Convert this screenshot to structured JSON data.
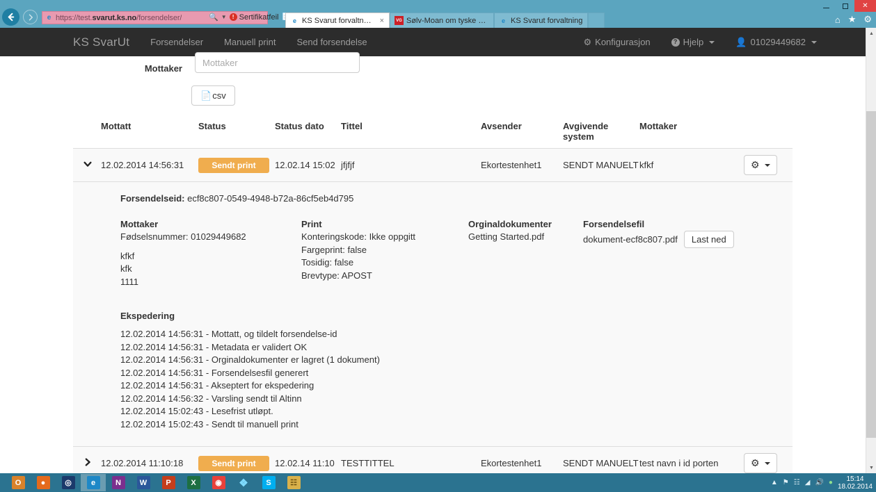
{
  "browser": {
    "url_prefix": "https://test.",
    "url_domain": "svarut.ks.no",
    "url_path": "/forsendelser/",
    "security_warning": "Sertifikatfeil",
    "back_icon": "back-arrow-icon",
    "forward_icon": "forward-arrow-icon",
    "search_icon": "search-icon",
    "refresh_icon": "refresh-icon",
    "home_icon": "home-icon",
    "favorites_icon": "star-icon",
    "tools_icon": "gear-icon",
    "minimize_label": "─",
    "maximize_label": "❐",
    "close_label": "✕",
    "tabs": [
      {
        "title": "KS Svarut forvaltning",
        "active": true,
        "icon": "ie-icon",
        "close": "×"
      },
      {
        "title": "Sølv-Moan om tyske konkure...",
        "active": false,
        "icon": "news-icon",
        "close": ""
      },
      {
        "title": "KS Svarut forvaltning",
        "active": false,
        "icon": "ie-icon",
        "close": ""
      }
    ]
  },
  "navbar": {
    "brand": "KS SvarUt",
    "links": [
      {
        "label": "Forsendelser"
      },
      {
        "label": "Manuell print"
      },
      {
        "label": "Send forsendelse"
      }
    ],
    "right": [
      {
        "label": "Konfigurasjon",
        "icon": "gear-icon",
        "caret": false
      },
      {
        "label": "Hjelp",
        "icon": "question-circle-icon",
        "caret": true
      },
      {
        "label": "01029449682",
        "icon": "user-icon",
        "caret": true
      }
    ]
  },
  "filter": {
    "mottaker_label": "Mottaker",
    "mottaker_value": "",
    "mottaker_placeholder": "Mottaker",
    "csv_button": "csv",
    "csv_icon": "file-icon"
  },
  "table": {
    "headers": {
      "mottatt": "Mottatt",
      "status": "Status",
      "status_dato": "Status dato",
      "tittel": "Tittel",
      "avsender": "Avsender",
      "avgivende_system": "Avgivende system",
      "mottaker": "Mottaker"
    },
    "rows": [
      {
        "expanded": true,
        "caret": "⌄",
        "mottatt": "12.02.2014 14:56:31",
        "status": "Sendt print",
        "status_dato": "12.02.14 15:02",
        "tittel": "jfjfjf",
        "avsender": "Ekortestenhet1",
        "avgivende_system": "SENDT MANUELT",
        "mottaker": "kfkf",
        "actions_icon": "gear-icon",
        "detail": {
          "forsendelseid_label": "Forsendelseid:",
          "forsendelseid_value": "ecf8c807-0549-4948-b72a-86cf5eb4d795",
          "mottaker_heading": "Mottaker",
          "mottaker_lines": [
            "Fødselsnummer: 01029449682",
            "",
            "kfkf",
            "kfk",
            "1111"
          ],
          "print_heading": "Print",
          "print_lines": [
            "Konteringskode: Ikke oppgitt",
            "Fargeprint: false",
            "Tosidig: false",
            "Brevtype: APOST"
          ],
          "orginaldokumenter_heading": "Orginaldokumenter",
          "orginaldokumenter_lines": [
            "Getting Started.pdf"
          ],
          "forsendelsefil_heading": "Forsendelsefil",
          "forsendelsefil_name": "dokument-ecf8c807.pdf",
          "forsendelsefil_button": "Last ned",
          "ekspedering_heading": "Ekspedering",
          "ekspedering_lines": [
            "12.02.2014 14:56:31 - Mottatt, og tildelt forsendelse-id",
            "12.02.2014 14:56:31 - Metadata er validert OK",
            "12.02.2014 14:56:31 - Orginaldokumenter er lagret (1 dokument)",
            "12.02.2014 14:56:31 - Forsendelsesfil generert",
            "12.02.2014 14:56:31 - Akseptert for ekspedering",
            "12.02.2014 14:56:32 - Varsling sendt til Altinn",
            "12.02.2014 15:02:43 - Lesefrist utløpt.",
            "12.02.2014 15:02:43 - Sendt til manuell print"
          ]
        }
      },
      {
        "expanded": false,
        "caret": "❯",
        "mottatt": "12.02.2014 11:10:18",
        "status": "Sendt print",
        "status_dato": "12.02.14 11:10",
        "tittel": "TESTTITTEL",
        "avsender": "Ekortestenhet1",
        "avgivende_system": "SENDT MANUELT",
        "mottaker": "test navn i id porten",
        "actions_icon": "gear-icon"
      }
    ]
  },
  "colors": {
    "navbar_bg": "#2c2c2c",
    "badge_orange": "#f0ad4e",
    "chrome_blue": "#5ba5bf",
    "taskbar_blue": "#2b7390"
  },
  "taskbar": {
    "items": [
      {
        "name": "outlook",
        "glyph": "O",
        "bg": "#d9822b",
        "active": false
      },
      {
        "name": "firefox",
        "glyph": "●",
        "bg": "#e56a1c",
        "active": false
      },
      {
        "name": "nav-app",
        "glyph": "◎",
        "bg": "#1b3a6b",
        "active": false
      },
      {
        "name": "internet-explorer",
        "glyph": "e",
        "bg": "#1e88c7",
        "active": true
      },
      {
        "name": "onenote",
        "glyph": "N",
        "bg": "#7b2f8e",
        "active": false
      },
      {
        "name": "word",
        "glyph": "W",
        "bg": "#2b579a",
        "active": false
      },
      {
        "name": "powerpoint",
        "glyph": "P",
        "bg": "#c43e1c",
        "active": false
      },
      {
        "name": "excel",
        "glyph": "X",
        "bg": "#1d6f42",
        "active": false
      },
      {
        "name": "chrome",
        "glyph": "◉",
        "bg": "#e8413a",
        "active": false
      },
      {
        "name": "dropbox",
        "glyph": "❖",
        "bg": "#2b7390",
        "active": false
      },
      {
        "name": "skype",
        "glyph": "S",
        "bg": "#00aff0",
        "active": false
      },
      {
        "name": "notes",
        "glyph": "☷",
        "bg": "#d9b14b",
        "active": false
      }
    ],
    "tray": {
      "show_hidden_icon": "chevron-up-icon",
      "flag_icon": "flag-icon",
      "network_icon": "network-icon",
      "signal_icon": "signal-icon",
      "volume_icon": "volume-icon",
      "shield_icon": "shield-icon",
      "time": "15:14",
      "date": "18.02.2014"
    }
  }
}
